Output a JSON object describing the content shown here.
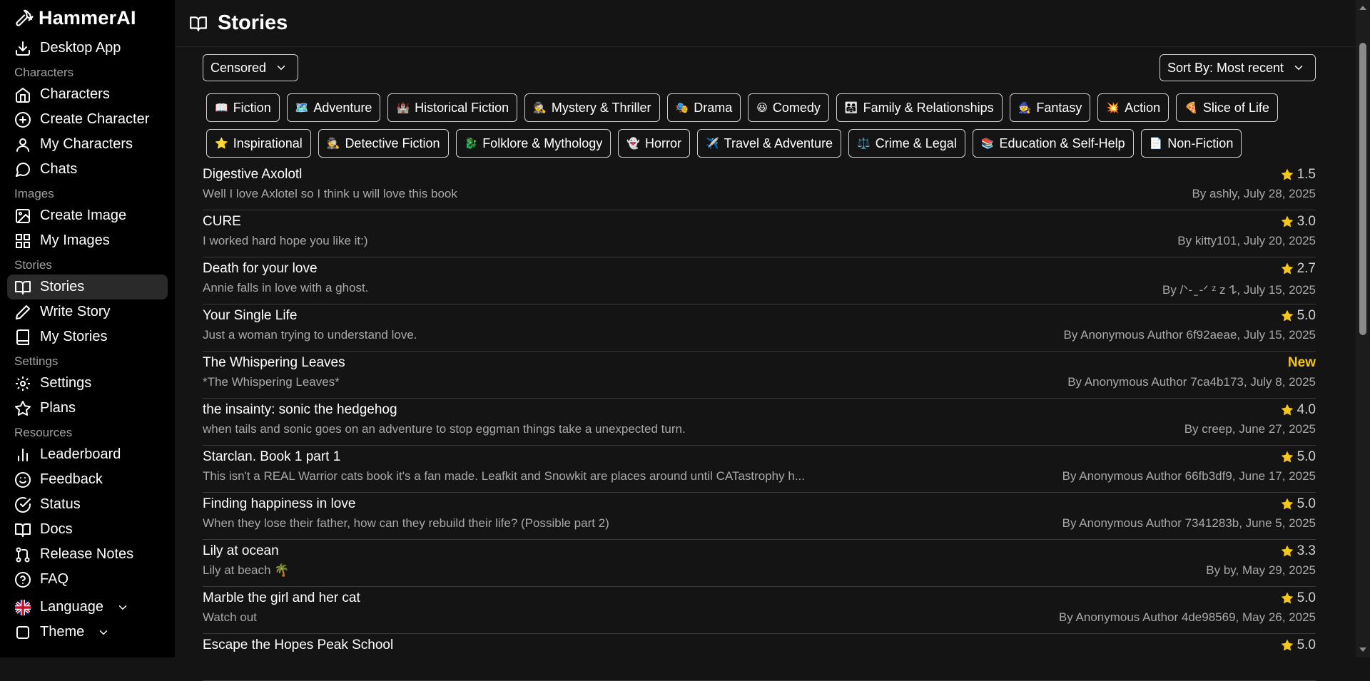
{
  "app": {
    "name": "HammerAI"
  },
  "sidebar": {
    "desktop_app": "Desktop App",
    "sections": {
      "characters": "Characters",
      "images": "Images",
      "stories": "Stories",
      "settings": "Settings",
      "resources": "Resources"
    },
    "items": {
      "characters": "Characters",
      "create_character": "Create Character",
      "my_characters": "My Characters",
      "chats": "Chats",
      "create_image": "Create Image",
      "my_images": "My Images",
      "stories": "Stories",
      "write_story": "Write Story",
      "my_stories": "My Stories",
      "settings": "Settings",
      "plans": "Plans",
      "leaderboard": "Leaderboard",
      "feedback": "Feedback",
      "status": "Status",
      "docs": "Docs",
      "release_notes": "Release Notes",
      "faq": "FAQ",
      "language": "Language",
      "theme": "Theme"
    }
  },
  "page": {
    "title": "Stories"
  },
  "filters": {
    "censor": "Censored",
    "sort": "Sort By: Most recent"
  },
  "genres": [
    {
      "emoji": "📖",
      "label": "Fiction"
    },
    {
      "emoji": "🗺️",
      "label": "Adventure"
    },
    {
      "emoji": "🏰",
      "label": "Historical Fiction"
    },
    {
      "emoji": "🕵️",
      "label": "Mystery & Thriller"
    },
    {
      "emoji": "🎭",
      "label": "Drama"
    },
    {
      "emoji": "😆",
      "label": "Comedy"
    },
    {
      "emoji": "👨‍👩‍👧",
      "label": "Family & Relationships"
    },
    {
      "emoji": "🧙",
      "label": "Fantasy"
    },
    {
      "emoji": "💥",
      "label": "Action"
    },
    {
      "emoji": "🍕",
      "label": "Slice of Life"
    },
    {
      "emoji": "⭐",
      "label": "Inspirational"
    },
    {
      "emoji": "🕵️",
      "label": "Detective Fiction"
    },
    {
      "emoji": "🐉",
      "label": "Folklore & Mythology"
    },
    {
      "emoji": "👻",
      "label": "Horror"
    },
    {
      "emoji": "✈️",
      "label": "Travel & Adventure"
    },
    {
      "emoji": "⚖️",
      "label": "Crime & Legal"
    },
    {
      "emoji": "📚",
      "label": "Education & Self-Help"
    },
    {
      "emoji": "📄",
      "label": "Non-Fiction"
    }
  ],
  "stories": [
    {
      "title": "Digestive Axolotl",
      "desc": "Well I love Axlotel so I think u will love this book",
      "rating": "1.5",
      "author": "By ashly, July 28, 2025"
    },
    {
      "title": "CURE",
      "desc": "I worked hard hope you like it:)",
      "rating": "3.0",
      "author": "By kitty101, July 20, 2025"
    },
    {
      "title": "Death for your love",
      "desc": "Annie falls in love with a ghost.",
      "rating": "2.7",
      "author": "By /ᐠ- ̫ -ᐟ ᶻ z 𐰁, July 15, 2025"
    },
    {
      "title": "Your Single Life",
      "desc": "Just a woman trying to understand love.",
      "rating": "5.0",
      "author": "By Anonymous Author 6f92aeae, July 15, 2025"
    },
    {
      "title": "The Whispering Leaves",
      "desc": "*The Whispering Leaves*",
      "badge": "New",
      "author": "By Anonymous Author 7ca4b173, July 8, 2025"
    },
    {
      "title": "the insainty: sonic the hedgehog",
      "desc": "when tails and sonic goes on an adventure to stop eggman things take a unexpected turn.",
      "rating": "4.0",
      "author": "By creep, June 27, 2025"
    },
    {
      "title": "Starclan. Book 1 part 1",
      "desc": "This isn't a REAL Warrior cats book it's a fan made. Leafkit and Snowkit are places around until CATastrophy h...",
      "rating": "5.0",
      "author": "By Anonymous Author 66fb3df9, June 17, 2025"
    },
    {
      "title": "Finding happiness in love",
      "desc": "When they lose their father, how can they rebuild their life? (Possible part 2)",
      "rating": "5.0",
      "author": "By Anonymous Author 7341283b, June 5, 2025"
    },
    {
      "title": "Lily at ocean",
      "desc": "Lily at beach 🌴",
      "rating": "3.3",
      "author": "By by, May 29, 2025"
    },
    {
      "title": "Marble the girl and her cat",
      "desc": "Watch out",
      "rating": "5.0",
      "author": "By Anonymous Author 4de98569, May 26, 2025"
    },
    {
      "title": "Escape the Hopes Peak School",
      "desc": "",
      "rating": "5.0",
      "author": ""
    }
  ],
  "colors": {
    "star": "#f5c518",
    "new_badge": "#f5c518",
    "active_nav": "#2a2a2a"
  }
}
